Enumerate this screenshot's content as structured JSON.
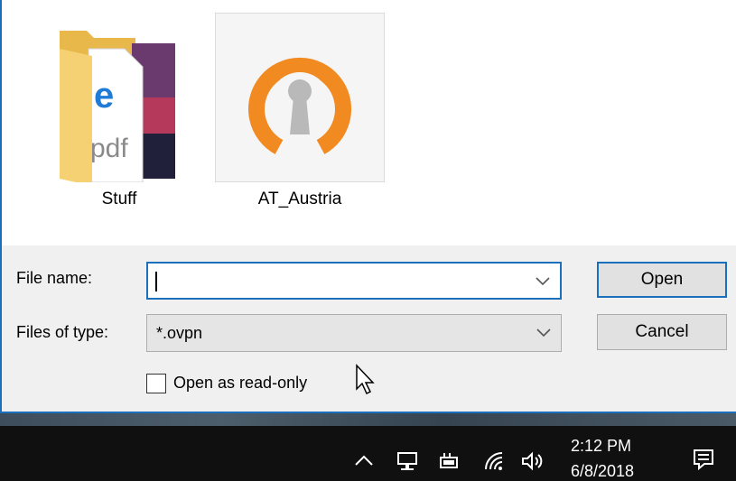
{
  "files": [
    {
      "name": "Stuff",
      "icon": "folder-icon",
      "selected": false
    },
    {
      "name": "AT_Austria",
      "icon": "openvpn-config-icon",
      "selected": true
    }
  ],
  "form": {
    "file_name_label": "File name:",
    "file_name_value": "",
    "files_of_type_label": "Files of type:",
    "files_of_type_value": "*.ovpn",
    "read_only_label": "Open as read-only",
    "read_only_checked": false
  },
  "buttons": {
    "open": "Open",
    "cancel": "Cancel"
  },
  "taskbar": {
    "time": "2:12 PM",
    "date": "6/8/2018",
    "tray_icons": [
      "chevron-up-icon",
      "network-icon",
      "battery-icon",
      "wifi-icon",
      "volume-icon"
    ],
    "action_center_icon": "notification-icon"
  },
  "colors": {
    "accent": "#1c6fbd",
    "openvpn_orange": "#f18a21"
  }
}
